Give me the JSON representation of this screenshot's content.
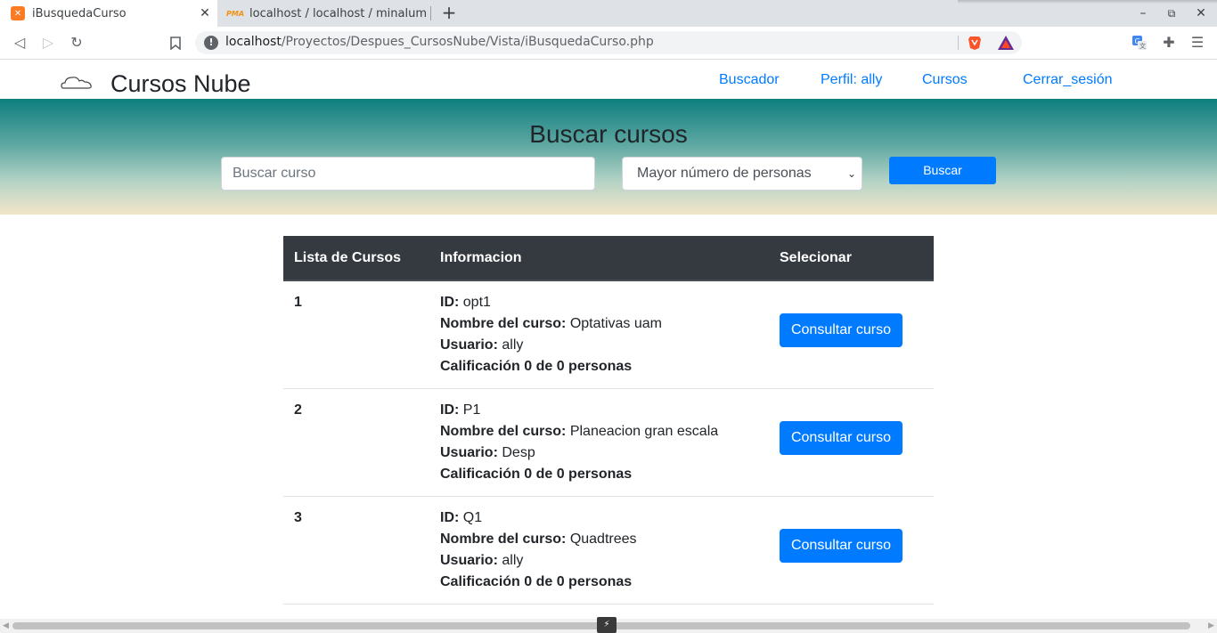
{
  "browser": {
    "tabs": [
      {
        "title": "iBusquedaCurso",
        "favicon": "xampp-icon",
        "active": true
      },
      {
        "title": "localhost / localhost / minalum",
        "favicon": "phpmyadmin-icon",
        "active": false
      }
    ],
    "new_tab": "+",
    "address": {
      "host": "localhost",
      "path": "/Proyectos/Despues_CursosNube/Vista/iBusquedaCurso.php"
    }
  },
  "site": {
    "brand": "Cursos Nube",
    "nav": [
      {
        "label": "Buscador"
      },
      {
        "label": "Perfil: ally"
      },
      {
        "label": "Cursos"
      },
      {
        "label": "Cerrar_sesión"
      }
    ]
  },
  "search": {
    "title": "Buscar cursos",
    "placeholder": "Buscar curso",
    "value": "",
    "sort_selected": "Mayor número de personas",
    "button_label": "Buscar"
  },
  "table": {
    "headers": [
      "Lista de Cursos",
      "Informacion",
      "Selecionar"
    ],
    "labels": {
      "id": "ID:",
      "name": "Nombre del curso:",
      "user": "Usuario:"
    },
    "button_label": "Consultar curso",
    "rows": [
      {
        "num": "1",
        "id": "opt1",
        "name": "Optativas uam",
        "user": "ally",
        "rating": "Calificación 0 de 0 personas"
      },
      {
        "num": "2",
        "id": "P1",
        "name": "Planeacion gran escala",
        "user": "Desp",
        "rating": "Calificación 0 de 0 personas"
      },
      {
        "num": "3",
        "id": "Q1",
        "name": "Quadtrees",
        "user": "ally",
        "rating": "Calificación 0 de 0 personas"
      }
    ]
  },
  "colors": {
    "link": "#007bff",
    "table_header": "#343a40",
    "hero_top": "#0e7f7f",
    "hero_bottom": "#f2e5c8"
  }
}
